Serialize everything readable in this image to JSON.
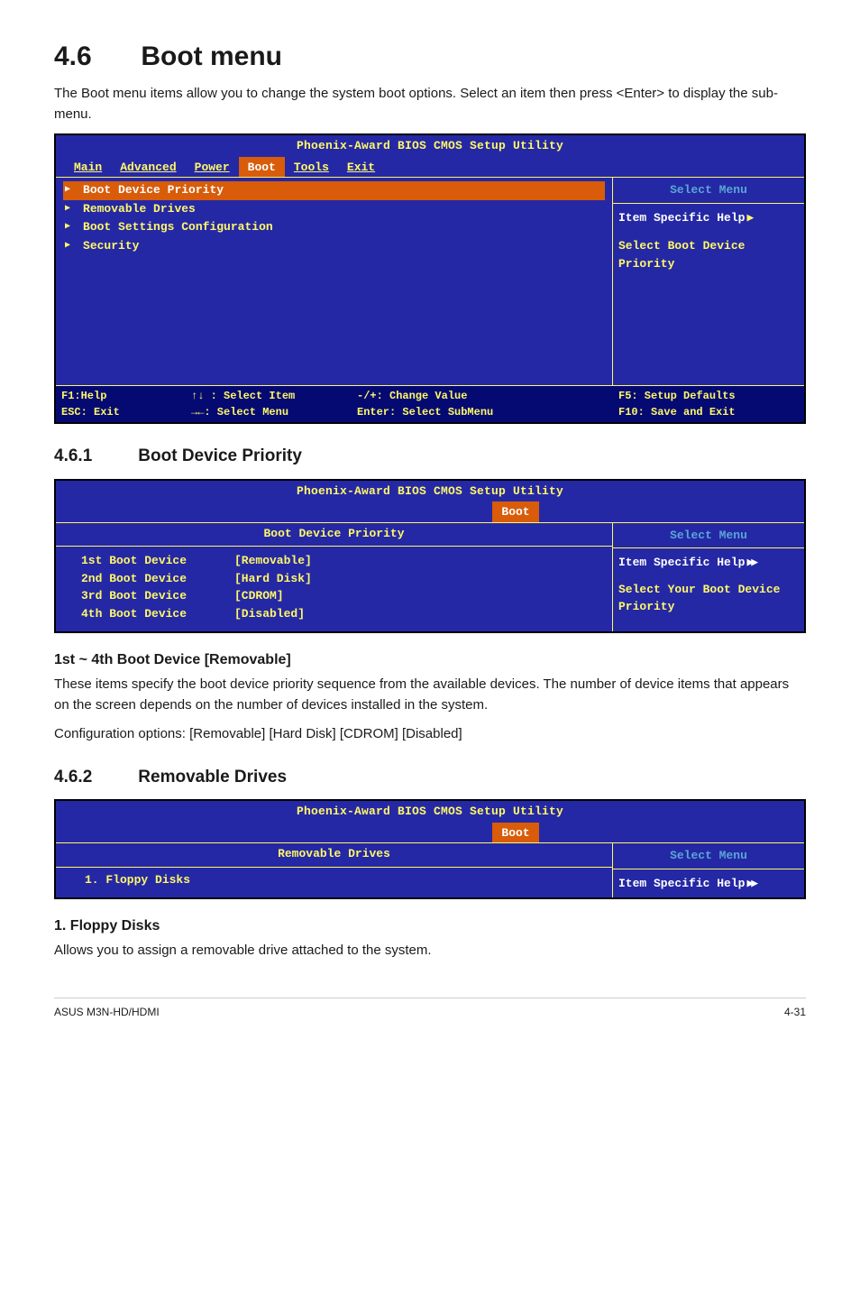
{
  "page": {
    "heading_num": "4.6",
    "heading_title": "Boot menu",
    "intro": "The Boot menu items allow you to change the system boot options. Select an item then press <Enter> to display the sub-menu.",
    "sec461_num": "4.6.1",
    "sec461_title": "Boot Device Priority",
    "sec462_num": "4.6.2",
    "sec462_title": "Removable Drives",
    "bd_hdr": "1st ~ 4th Boot Device [Removable]",
    "bd_p1": "These items specify the boot device priority sequence from the available devices. The number of device items that appears on the screen depends on the number of devices installed in the system.",
    "bd_p2": "Configuration options: [Removable] [Hard Disk] [CDROM] [Disabled]",
    "fd_hdr": "1. Floppy Disks",
    "fd_p": "Allows you to assign a removable drive attached to the system.",
    "foot_left": "ASUS M3N-HD/HDMI",
    "foot_right": "4-31"
  },
  "bios_main": {
    "title": "Phoenix-Award BIOS CMOS Setup Utility",
    "tabs": {
      "main": "Main",
      "adv": "Advanced",
      "power": "Power",
      "boot": "Boot",
      "tools": "Tools",
      "exit": "Exit"
    },
    "items": {
      "bdp": "Boot Device Priority",
      "rd": "Removable Drives",
      "bsc": "Boot Settings Configuration",
      "sec": "Security"
    },
    "right_title": "Select Menu",
    "right_help": "Item Specific Help",
    "right_hint": "Select Boot Device Priority",
    "footer": {
      "a1": "F1:Help",
      "b1": "↑↓ : Select Item",
      "c1": "-/+: Change Value",
      "d1": "F5: Setup Defaults",
      "a2": "ESC: Exit",
      "b2": "→←: Select Menu",
      "c2": "Enter: Select SubMenu",
      "d2": "F10: Save and Exit"
    }
  },
  "bios_bdp": {
    "title": "Phoenix-Award BIOS CMOS Setup Utility",
    "tab": "Boot",
    "subtitle": "Boot Device Priority",
    "rows": {
      "r1l": "1st Boot Device",
      "r1v": "[Removable]",
      "r2l": "2nd Boot Device",
      "r2v": "[Hard Disk]",
      "r3l": "3rd Boot Device",
      "r3v": "[CDROM]",
      "r4l": "4th Boot Device",
      "r4v": "[Disabled]"
    },
    "right_title": "Select Menu",
    "right_help": "Item Specific Help",
    "right_hint": "Select Your Boot Device Priority"
  },
  "bios_rd": {
    "title": "Phoenix-Award BIOS CMOS Setup Utility",
    "tab": "Boot",
    "subtitle": "Removable Drives",
    "row": "1. Floppy Disks",
    "right_title": "Select Menu",
    "right_help": "Item Specific Help"
  }
}
